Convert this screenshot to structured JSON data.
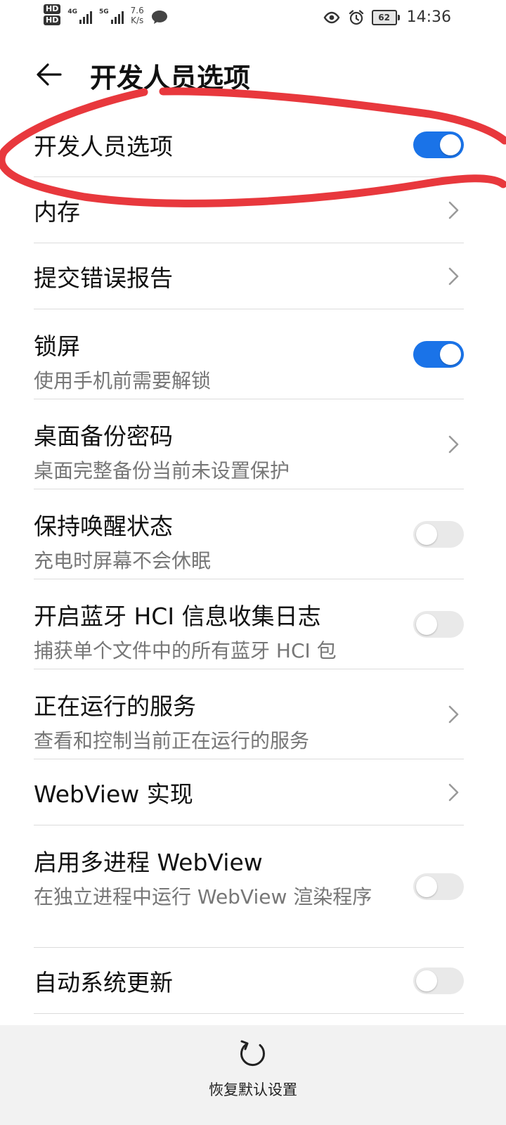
{
  "status_bar": {
    "hd1": "HD",
    "hd2": "HD",
    "net1": "4G",
    "net2": "5G",
    "speed_value": "7.6",
    "speed_unit": "K/s",
    "battery": "62",
    "time": "14:36",
    "icons": [
      "hd-icon",
      "signal-icon",
      "chat-icon",
      "eye-icon",
      "alarm-icon",
      "battery-icon"
    ]
  },
  "header": {
    "title": "开发人员选项",
    "back_icon": "back-arrow-icon"
  },
  "settings": [
    {
      "id": "developer-options",
      "title": "开发人员选项",
      "subtitle": "",
      "control": "switch",
      "on": true
    },
    {
      "id": "memory",
      "title": "内存",
      "subtitle": "",
      "control": "chevron"
    },
    {
      "id": "bug-report",
      "title": "提交错误报告",
      "subtitle": "",
      "control": "chevron"
    },
    {
      "id": "screen-lock",
      "title": "锁屏",
      "subtitle": "使用手机前需要解锁",
      "control": "switch",
      "on": true
    },
    {
      "id": "desktop-backup-password",
      "title": "桌面备份密码",
      "subtitle": "桌面完整备份当前未设置保护",
      "control": "chevron"
    },
    {
      "id": "stay-awake",
      "title": "保持唤醒状态",
      "subtitle": "充电时屏幕不会休眠",
      "control": "switch",
      "on": false
    },
    {
      "id": "bluetooth-hci-log",
      "title": "开启蓝牙 HCI 信息收集日志",
      "subtitle": "捕获单个文件中的所有蓝牙 HCI 包",
      "control": "switch",
      "on": false
    },
    {
      "id": "running-services",
      "title": "正在运行的服务",
      "subtitle": "查看和控制当前正在运行的服务",
      "control": "chevron"
    },
    {
      "id": "webview-impl",
      "title": "WebView 实现",
      "subtitle": "",
      "control": "chevron"
    },
    {
      "id": "multiprocess-webview",
      "title": "启用多进程 WebView",
      "subtitle": "在独立进程中运行 WebView 渲染程序",
      "control": "switch",
      "on": false
    },
    {
      "id": "auto-system-update",
      "title": "自动系统更新",
      "subtitle": "",
      "control": "switch",
      "on": false
    }
  ],
  "footer": {
    "reset_label": "恢复默认设置",
    "reset_icon": "reset-icon"
  },
  "colors": {
    "accent": "#1a73e8",
    "annotation": "#e8383d",
    "switch_off": "#e9e9e9"
  }
}
